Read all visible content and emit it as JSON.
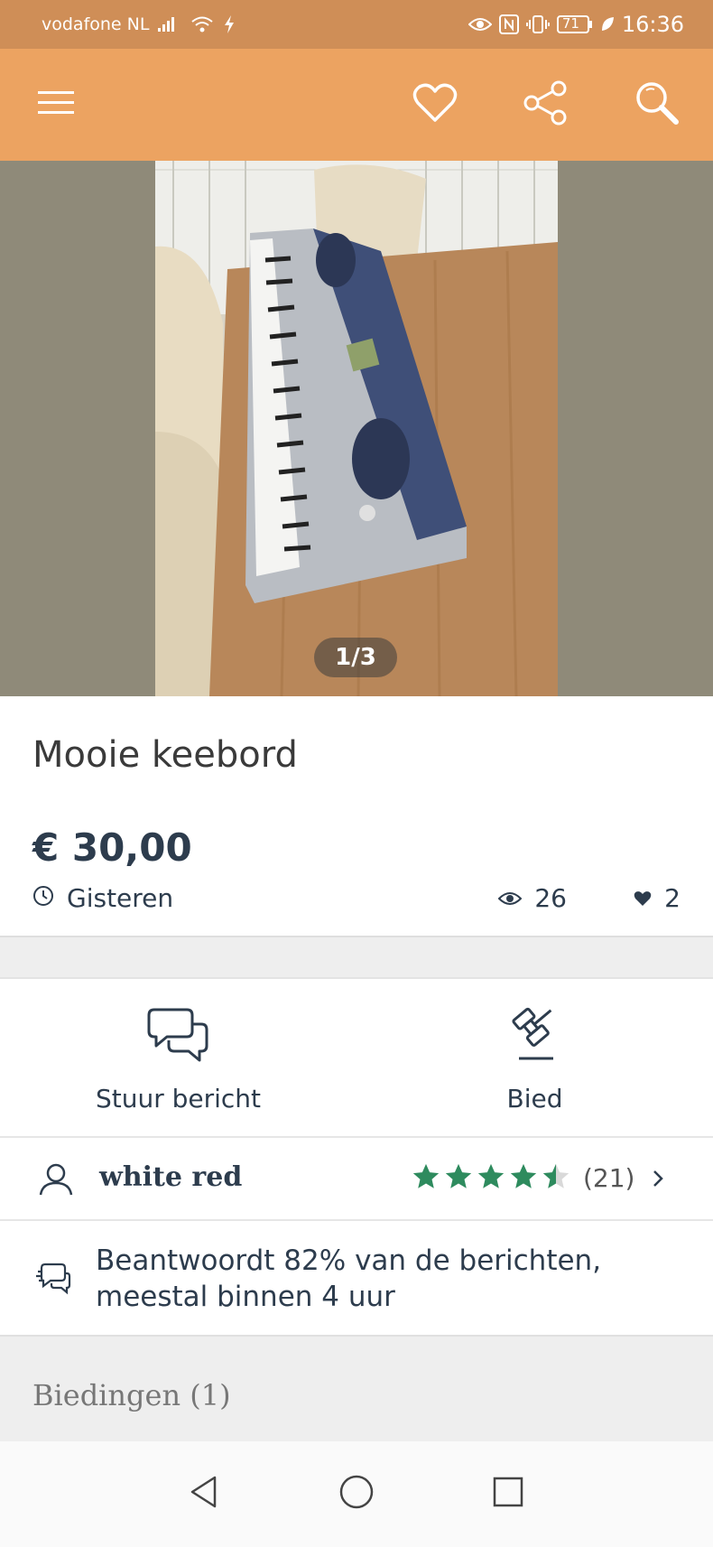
{
  "status_bar": {
    "carrier": "vodafone NL",
    "battery": "71",
    "time": "16:36"
  },
  "app_bar": {
    "menu_icon": "hamburger-icon",
    "favorite_icon": "heart-icon",
    "share_icon": "share-icon",
    "search_icon": "search-icon"
  },
  "gallery": {
    "counter": "1/3"
  },
  "listing": {
    "title": "Mooie keebord",
    "price": "€ 30,00",
    "posted": "Gisteren",
    "views": "26",
    "likes": "2"
  },
  "actions": {
    "message_label": "Stuur bericht",
    "bid_label": "Bied"
  },
  "seller": {
    "name": "white red",
    "rating": 4.5,
    "review_count": "(21)"
  },
  "response": {
    "line1": "Beantwoordt 82% van de berichten,",
    "line2": "meestal binnen 4 uur"
  },
  "bids": {
    "label": "Biedingen (1)"
  },
  "colors": {
    "status_bar": "#cf8e57",
    "app_bar": "#eca361",
    "star": "#2e8b5e",
    "text": "#2d3c4d"
  }
}
